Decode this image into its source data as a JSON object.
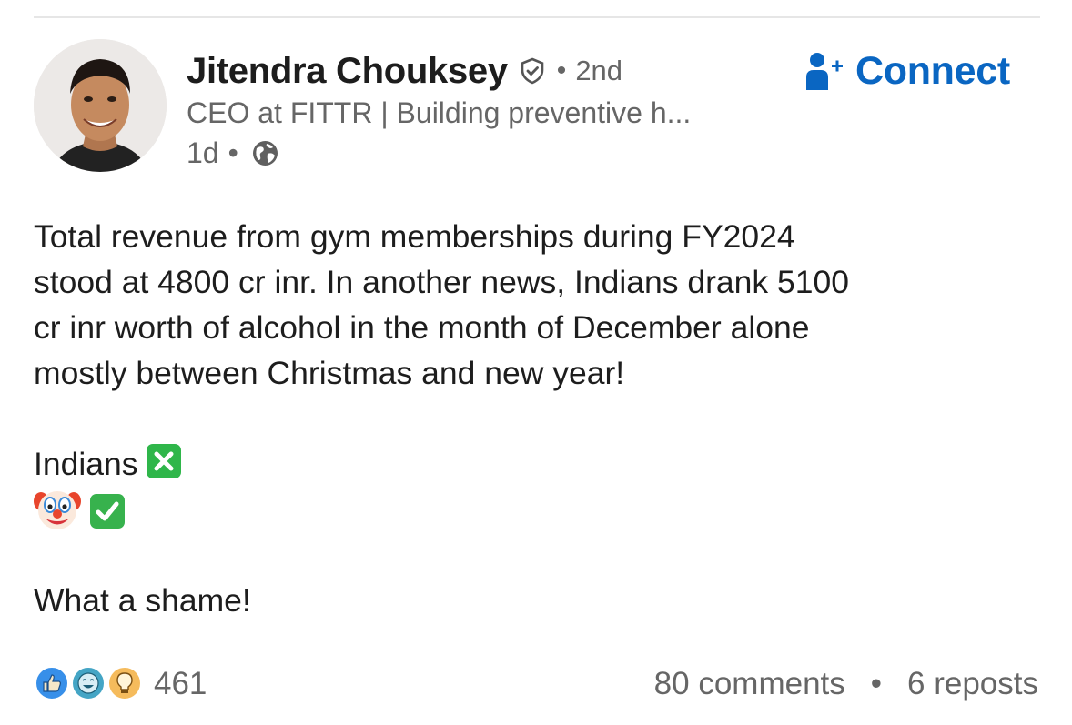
{
  "author": {
    "name": "Jitendra Chouksey",
    "degree": "2nd",
    "headline": "CEO at FITTR | Building preventive h...",
    "posted": "1d",
    "dot": "•"
  },
  "actions": {
    "connect_label": "Connect"
  },
  "post": {
    "lines": [
      "Total revenue from gym memberships during FY2024",
      "stood at 4800 cr inr. In another news, Indians drank 5100",
      "cr inr worth of alcohol in the month of December alone",
      "mostly between Christmas and new year!"
    ],
    "indians_label": "Indians",
    "closing": "What a shame!"
  },
  "social": {
    "reaction_count": "461",
    "comments": "80 comments",
    "reposts": "6 reposts",
    "separator": "•"
  },
  "icons": {
    "verified": "verified-shield-icon",
    "connect": "add-person-icon",
    "visibility": "globe-icon",
    "reactions": [
      "like-icon",
      "funny-icon",
      "insightful-icon"
    ],
    "emoji": [
      "cross-mark-emoji",
      "clown-face-emoji",
      "check-mark-emoji"
    ]
  },
  "colors": {
    "brand_blue": "#0a66c2",
    "muted_text": "#666666",
    "emoji_green": "#2fb64a"
  }
}
